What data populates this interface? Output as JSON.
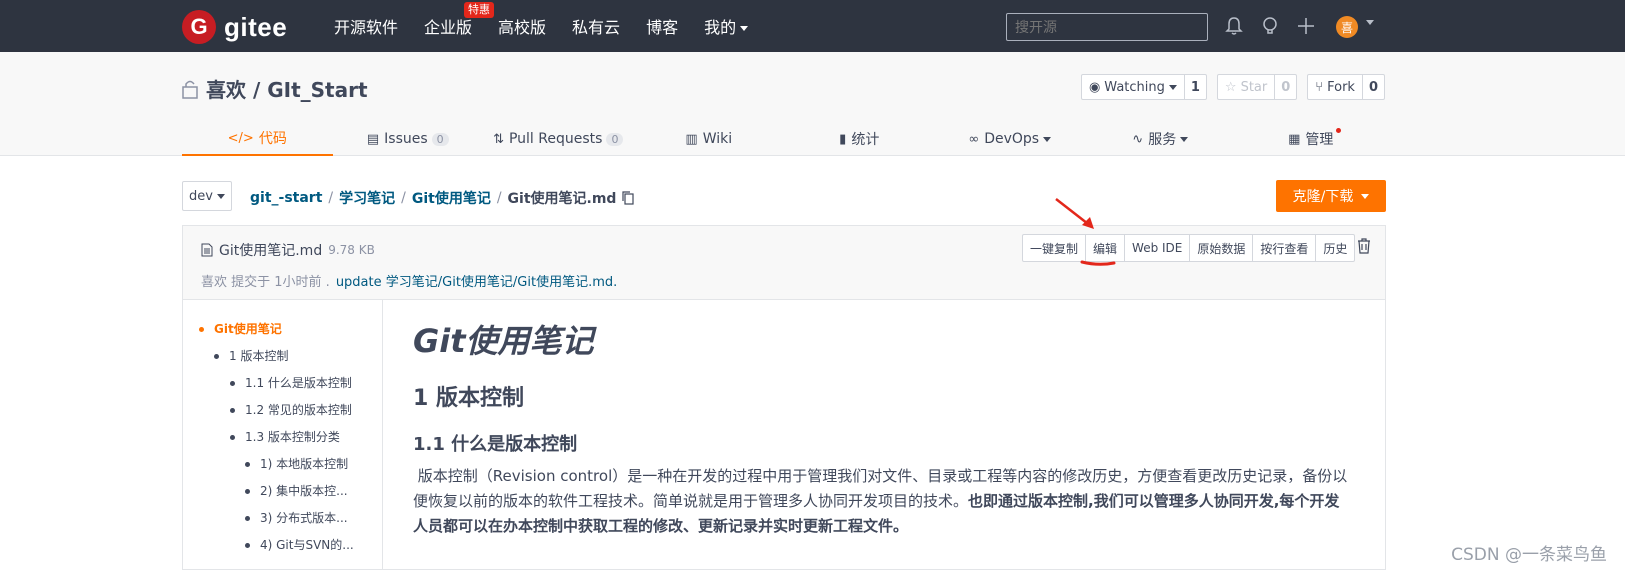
{
  "topnav": {
    "logo_letter": "G",
    "brand": "gitee",
    "links": [
      {
        "label": "开源软件"
      },
      {
        "label": "企业版",
        "badge": "特惠"
      },
      {
        "label": "高校版"
      },
      {
        "label": "私有云"
      },
      {
        "label": "博客"
      },
      {
        "label": "我的",
        "caret": true
      }
    ],
    "search_placeholder": "搜开源",
    "avatar_text": "喜"
  },
  "project": {
    "title": "喜欢 / GIt_Start",
    "buttons": [
      {
        "label": "Watching",
        "count": "1",
        "icon": "eye-icon"
      },
      {
        "label": "Star",
        "count": "0",
        "icon": "star-icon"
      },
      {
        "label": "Fork",
        "count": "0",
        "icon": "fork-icon"
      }
    ],
    "tabs": [
      {
        "label": "代码",
        "icon": "</>",
        "active": true
      },
      {
        "label": "Issues",
        "count": "0"
      },
      {
        "label": "Pull Requests",
        "count": "0"
      },
      {
        "label": "Wiki"
      },
      {
        "label": "统计"
      },
      {
        "label": "DevOps"
      },
      {
        "label": "服务"
      },
      {
        "label": "管理"
      }
    ]
  },
  "breadcrumb": {
    "branch": "dev",
    "parts": [
      "git_-start",
      "学习笔记",
      "Git使用笔记"
    ],
    "current": "Git使用笔记.md",
    "clone_label": "克隆/下载"
  },
  "file": {
    "name": "Git使用笔记.md",
    "size": "9.78 KB",
    "commit_author": "喜欢 提交于 1小时前 .",
    "commit_msg": "update 学习笔记/Git使用笔记/Git使用笔记.md.",
    "actions": [
      "一键复制",
      "编辑",
      "Web IDE",
      "原始数据",
      "按行查看",
      "历史"
    ]
  },
  "toc": [
    {
      "label": "Git使用笔记",
      "level": 0,
      "active": true
    },
    {
      "label": "1 版本控制",
      "level": 1
    },
    {
      "label": "1.1 什么是版本控制",
      "level": 2
    },
    {
      "label": "1.2 常见的版本控制",
      "level": 2
    },
    {
      "label": "1.3 版本控制分类",
      "level": 2
    },
    {
      "label": "1) 本地版本控制",
      "level": 3
    },
    {
      "label": "2) 集中版本控...",
      "level": 3
    },
    {
      "label": "3) 分布式版本...",
      "level": 3
    },
    {
      "label": "4) Git与SVN的...",
      "level": 3
    }
  ],
  "content": {
    "h1": "Git使用笔记",
    "h2": "1 版本控制",
    "h3": "1.1 什么是版本控制",
    "para_normal": "版本控制（Revision control）是一种在开发的过程中用于管理我们对文件、目录或工程等内容的修改历史，方便查看更改历史记录，备份以便恢复以前的版本的软件工程技术。简单说就是用于管理多人协同开发项目的技术。",
    "para_bold": "也即通过版本控制,我们可以管理多人协同开发,每个开发人员都可以在办本控制中获取工程的修改、更新记录并实时更新工程文件。"
  },
  "watermark": "CSDN @一条菜鸟鱼",
  "colors": {
    "accent": "#fe7300",
    "nav_bg": "#2e3440",
    "link": "#005980",
    "annotation": "#e3271b"
  }
}
